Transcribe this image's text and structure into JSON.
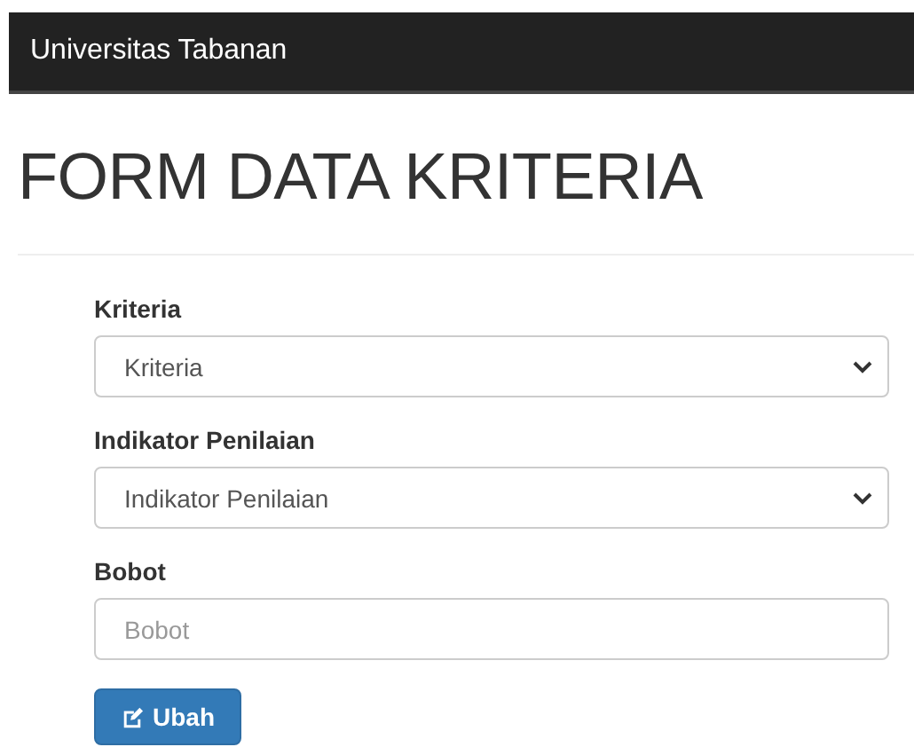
{
  "navbar": {
    "brand": "Universitas Tabanan"
  },
  "page_title": "FORM DATA KRITERIA",
  "fields": [
    {
      "kind": "select",
      "label": "Kriteria",
      "value": "Kriteria"
    },
    {
      "kind": "select",
      "label": "Indikator Penilaian",
      "value": "Indikator Penilaian"
    },
    {
      "kind": "input",
      "label": "Bobot",
      "placeholder": "Bobot"
    }
  ],
  "submit_button": {
    "label": "Ubah"
  }
}
